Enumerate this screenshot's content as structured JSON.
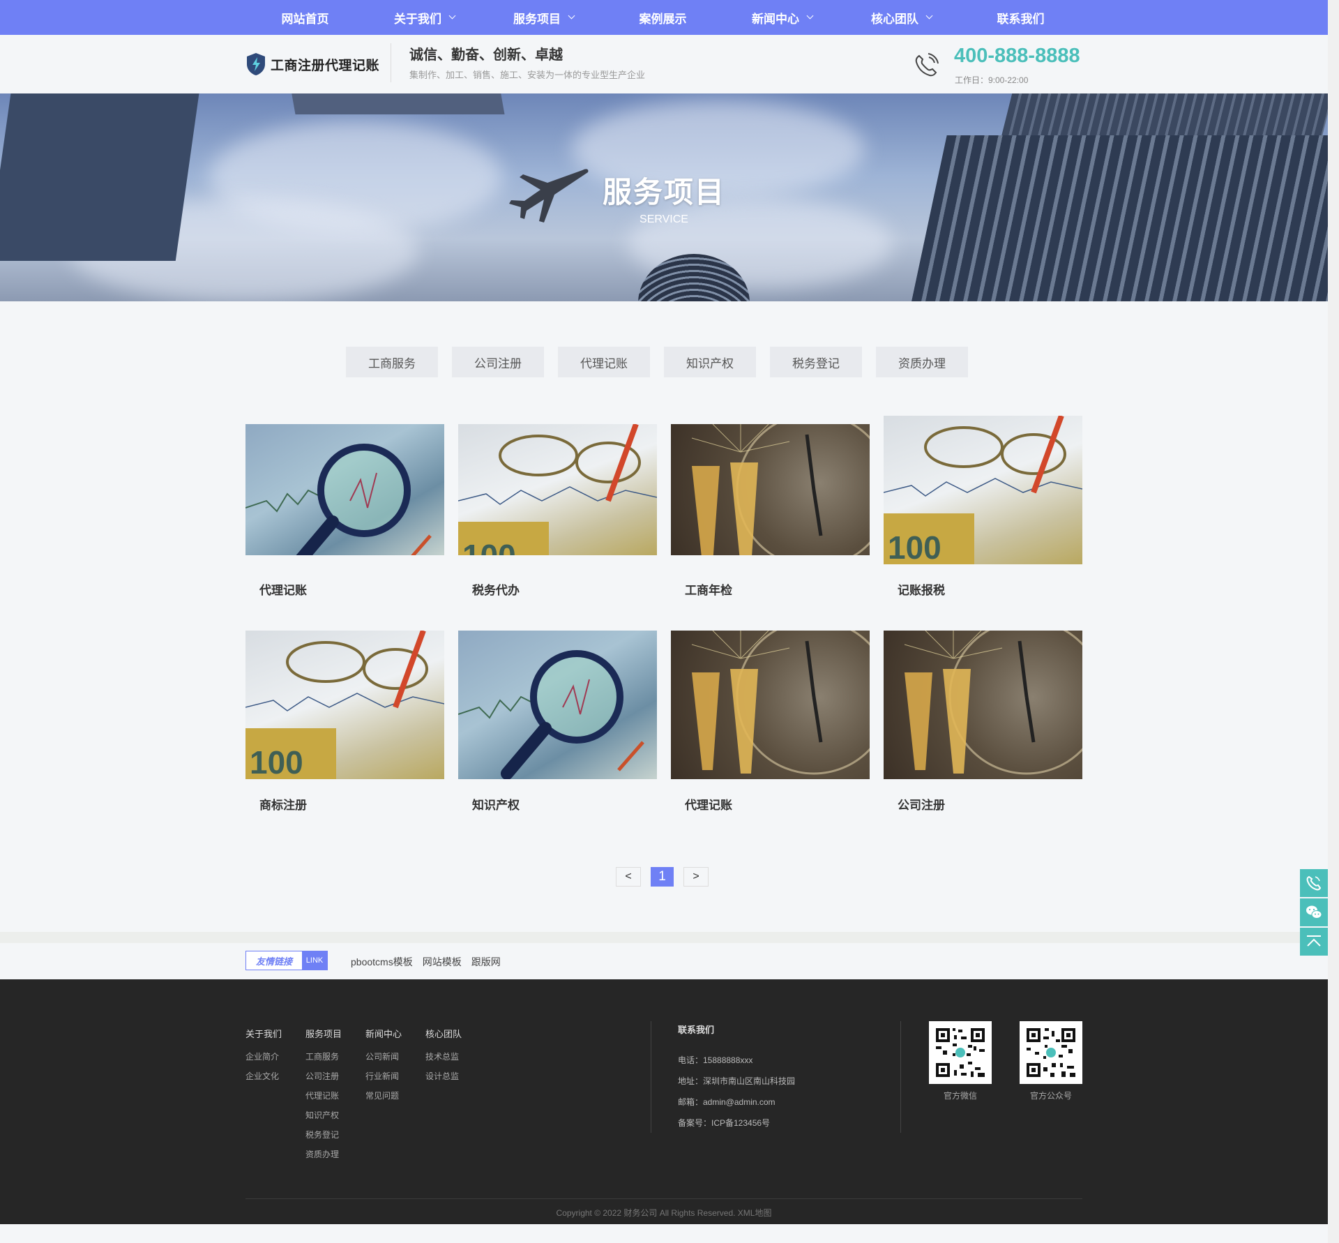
{
  "nav": {
    "items": [
      {
        "label": "网站首页",
        "dropdown": false
      },
      {
        "label": "关于我们",
        "dropdown": true
      },
      {
        "label": "服务项目",
        "dropdown": true
      },
      {
        "label": "案例展示",
        "dropdown": false
      },
      {
        "label": "新闻中心",
        "dropdown": true
      },
      {
        "label": "核心团队",
        "dropdown": true
      },
      {
        "label": "联系我们",
        "dropdown": false
      }
    ]
  },
  "header": {
    "logo_text": "工商注册代理记账",
    "slogan": "诚信、勤奋、创新、卓越",
    "slogan_sub": "集制作、加工、销售、施工、安装为一体的专业型生产企业",
    "phone": "400-888-8888",
    "hours": "工作日：9:00-22:00"
  },
  "banner": {
    "title": "服务项目",
    "subtitle": "SERVICE"
  },
  "tabs": [
    "工商服务",
    "公司注册",
    "代理记账",
    "知识产权",
    "税务登记",
    "资质办理"
  ],
  "cards": [
    {
      "title": "代理记账",
      "image": "magnifier"
    },
    {
      "title": "税务代办",
      "image": "glasses"
    },
    {
      "title": "工商年检",
      "image": "champagne"
    },
    {
      "title": "记账报税",
      "image": "glasses"
    },
    {
      "title": "商标注册",
      "image": "glasses"
    },
    {
      "title": "知识产权",
      "image": "magnifier"
    },
    {
      "title": "代理记账",
      "image": "champagne"
    },
    {
      "title": "公司注册",
      "image": "champagne"
    }
  ],
  "pager": {
    "prev": "<",
    "current": "1",
    "next": ">"
  },
  "links": {
    "label_cn": "友情链接",
    "label_en": "LINK",
    "items": [
      "pbootcms模板",
      "网站模板",
      "跟版网"
    ]
  },
  "footer": {
    "columns": [
      {
        "heading": "关于我们",
        "items": [
          "企业简介",
          "企业文化"
        ]
      },
      {
        "heading": "服务项目",
        "items": [
          "工商服务",
          "公司注册",
          "代理记账",
          "知识产权",
          "税务登记",
          "资质办理"
        ]
      },
      {
        "heading": "新闻中心",
        "items": [
          "公司新闻",
          "行业新闻",
          "常见问题"
        ]
      },
      {
        "heading": "核心团队",
        "items": [
          "技术总监",
          "设计总监"
        ]
      }
    ],
    "contact": {
      "heading": "联系我们",
      "phone": "电话：15888888xxx",
      "address": "地址：深圳市南山区南山科技园",
      "email": "邮箱：admin@admin.com",
      "icp": "备案号：ICP备123456号"
    },
    "qr": [
      {
        "caption": "官方微信"
      },
      {
        "caption": "官方公众号"
      }
    ],
    "copyright": "Copyright © 2022 财务公司 All Rights Reserved. XML地图"
  },
  "colors": {
    "accent": "#6f80f5",
    "teal": "#4bbfba",
    "footer_bg": "#262626"
  },
  "floating": [
    "phone-icon",
    "wechat-icon",
    "back-to-top-icon"
  ]
}
